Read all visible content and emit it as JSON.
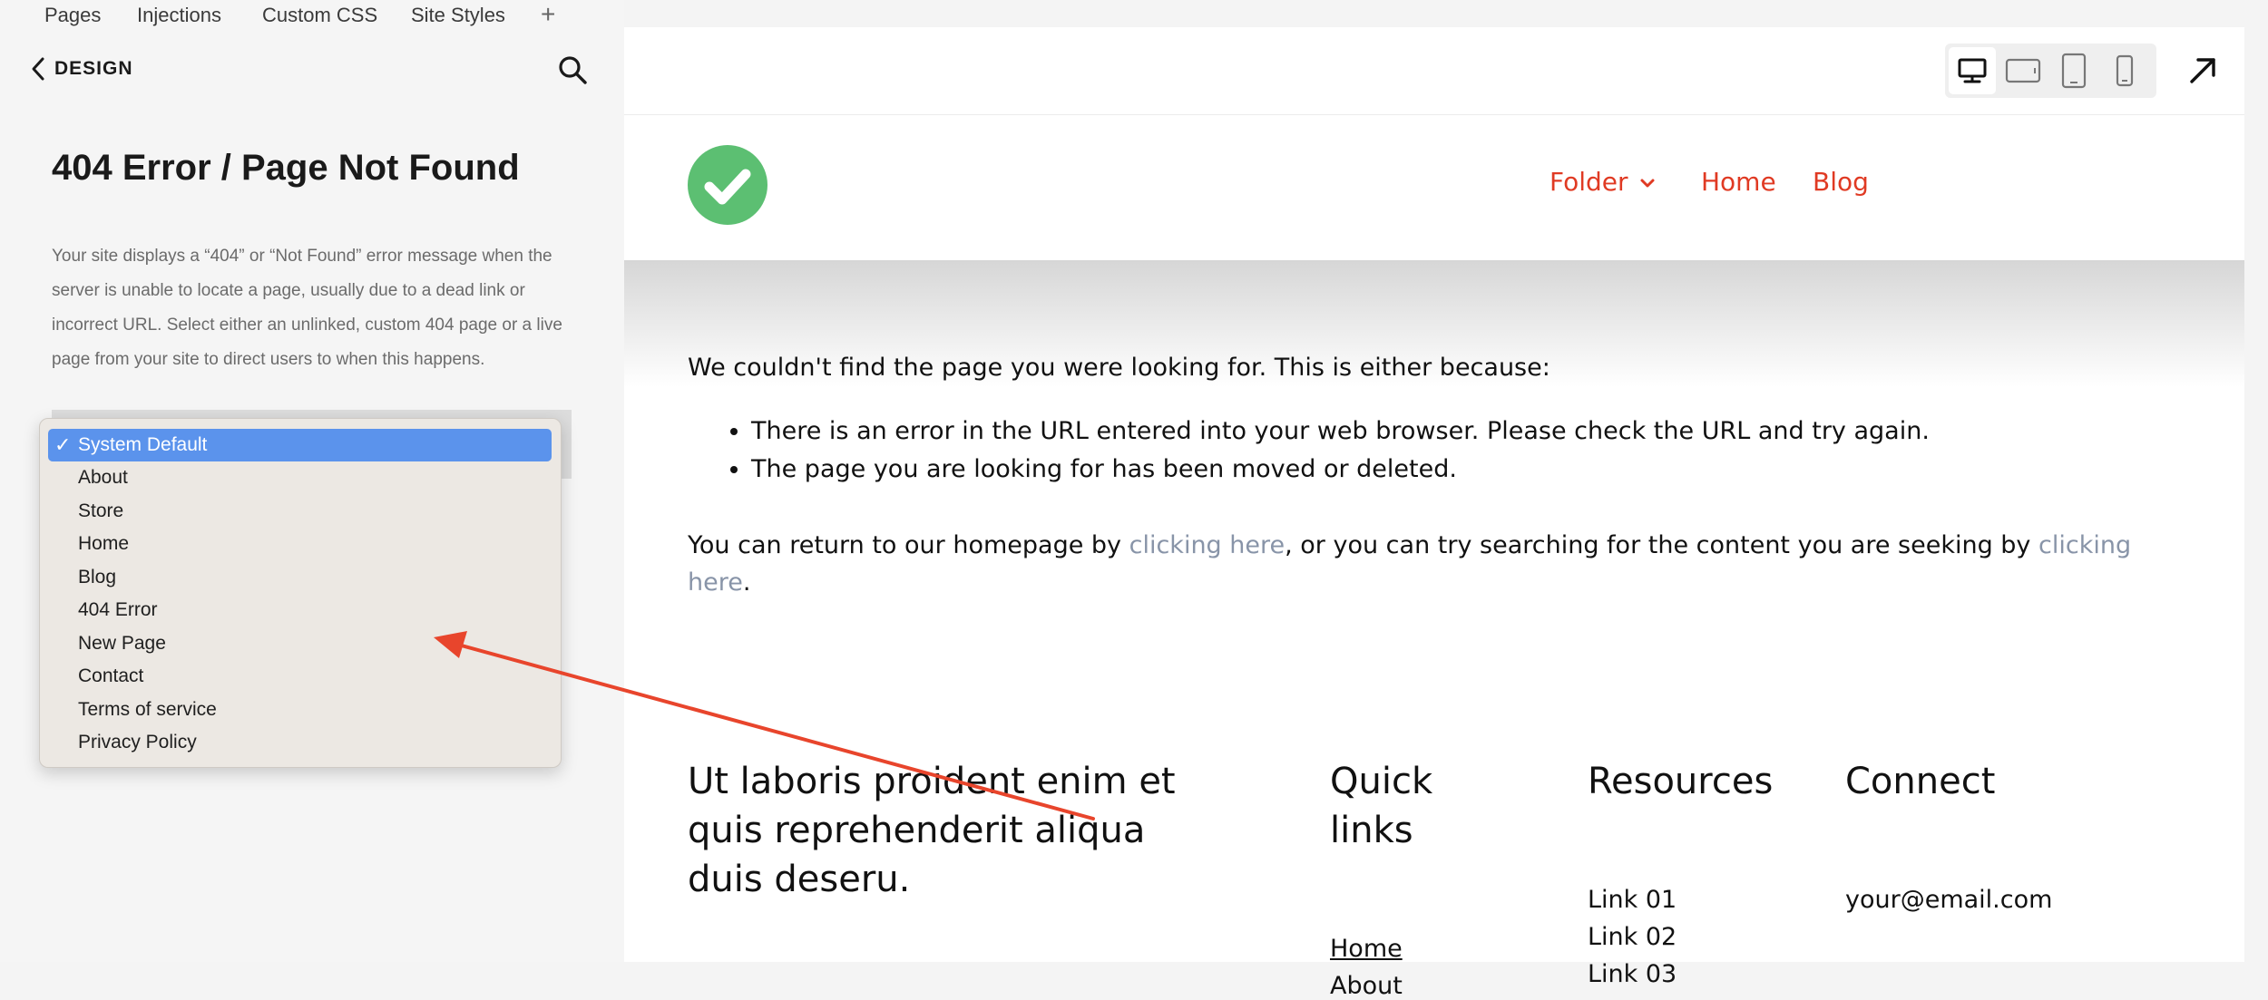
{
  "top_tabs": [
    "Pages",
    "Injections",
    "Custom CSS",
    "Site Styles"
  ],
  "add_tab_glyph": "+",
  "back_label": "DESIGN",
  "icons": {
    "back": "chevron-left-icon",
    "search": "search-icon",
    "desktop": "desktop-icon",
    "tablet_landscape": "tablet-landscape-icon",
    "tablet_portrait": "tablet-portrait-icon",
    "mobile": "mobile-icon",
    "expand": "expand-arrow-icon",
    "logo": "checkmark-circle-logo",
    "folder_chevron": "chevron-down-icon"
  },
  "panel": {
    "title": "404 Error / Page Not Found",
    "description": "Your site displays a “404” or “Not Found” error message when the server is unable to locate a page, usually due to a dead link or incorrect URL. Select either an unlinked, custom 404 page or a live page from your site to direct users to when this happens."
  },
  "dropdown": {
    "selected": "System Default",
    "check_glyph": "✓",
    "options": [
      "System Default",
      "About",
      "Store",
      "Home",
      "Blog",
      "404 Error",
      "New Page",
      "Contact",
      "Terms of service",
      "Privacy Policy"
    ]
  },
  "preview": {
    "nav": [
      "Folder",
      "Home",
      "Blog"
    ],
    "intro": "We couldn't find the page you were looking for. This is either because:",
    "reasons": [
      "There is an error in the URL entered into your web browser. Please check the URL and try again.",
      "The page you are looking for has been moved or deleted."
    ],
    "return_before": "You can return to our homepage by ",
    "link1": "clicking here",
    "return_middle": ", or you can try searching for the content you are seeking by ",
    "link2": "clicking here",
    "return_after": ".",
    "footer": {
      "tagline": "Ut laboris proident enim et quis reprehenderit aliqua duis deseru.",
      "quick_links_title": "Quick links",
      "quick_links": [
        "Home",
        "About"
      ],
      "resources_title": "Resources",
      "resources": [
        "Link 01",
        "Link 02",
        "Link 03"
      ],
      "connect_title": "Connect",
      "email": "your@email.com"
    }
  },
  "colors": {
    "accent_nav": "#e03a23",
    "link_gray": "#8894a8",
    "logo_green": "#5cbf72",
    "dropdown_highlight": "#5b93ec",
    "annotation_arrow": "#e8452c"
  }
}
